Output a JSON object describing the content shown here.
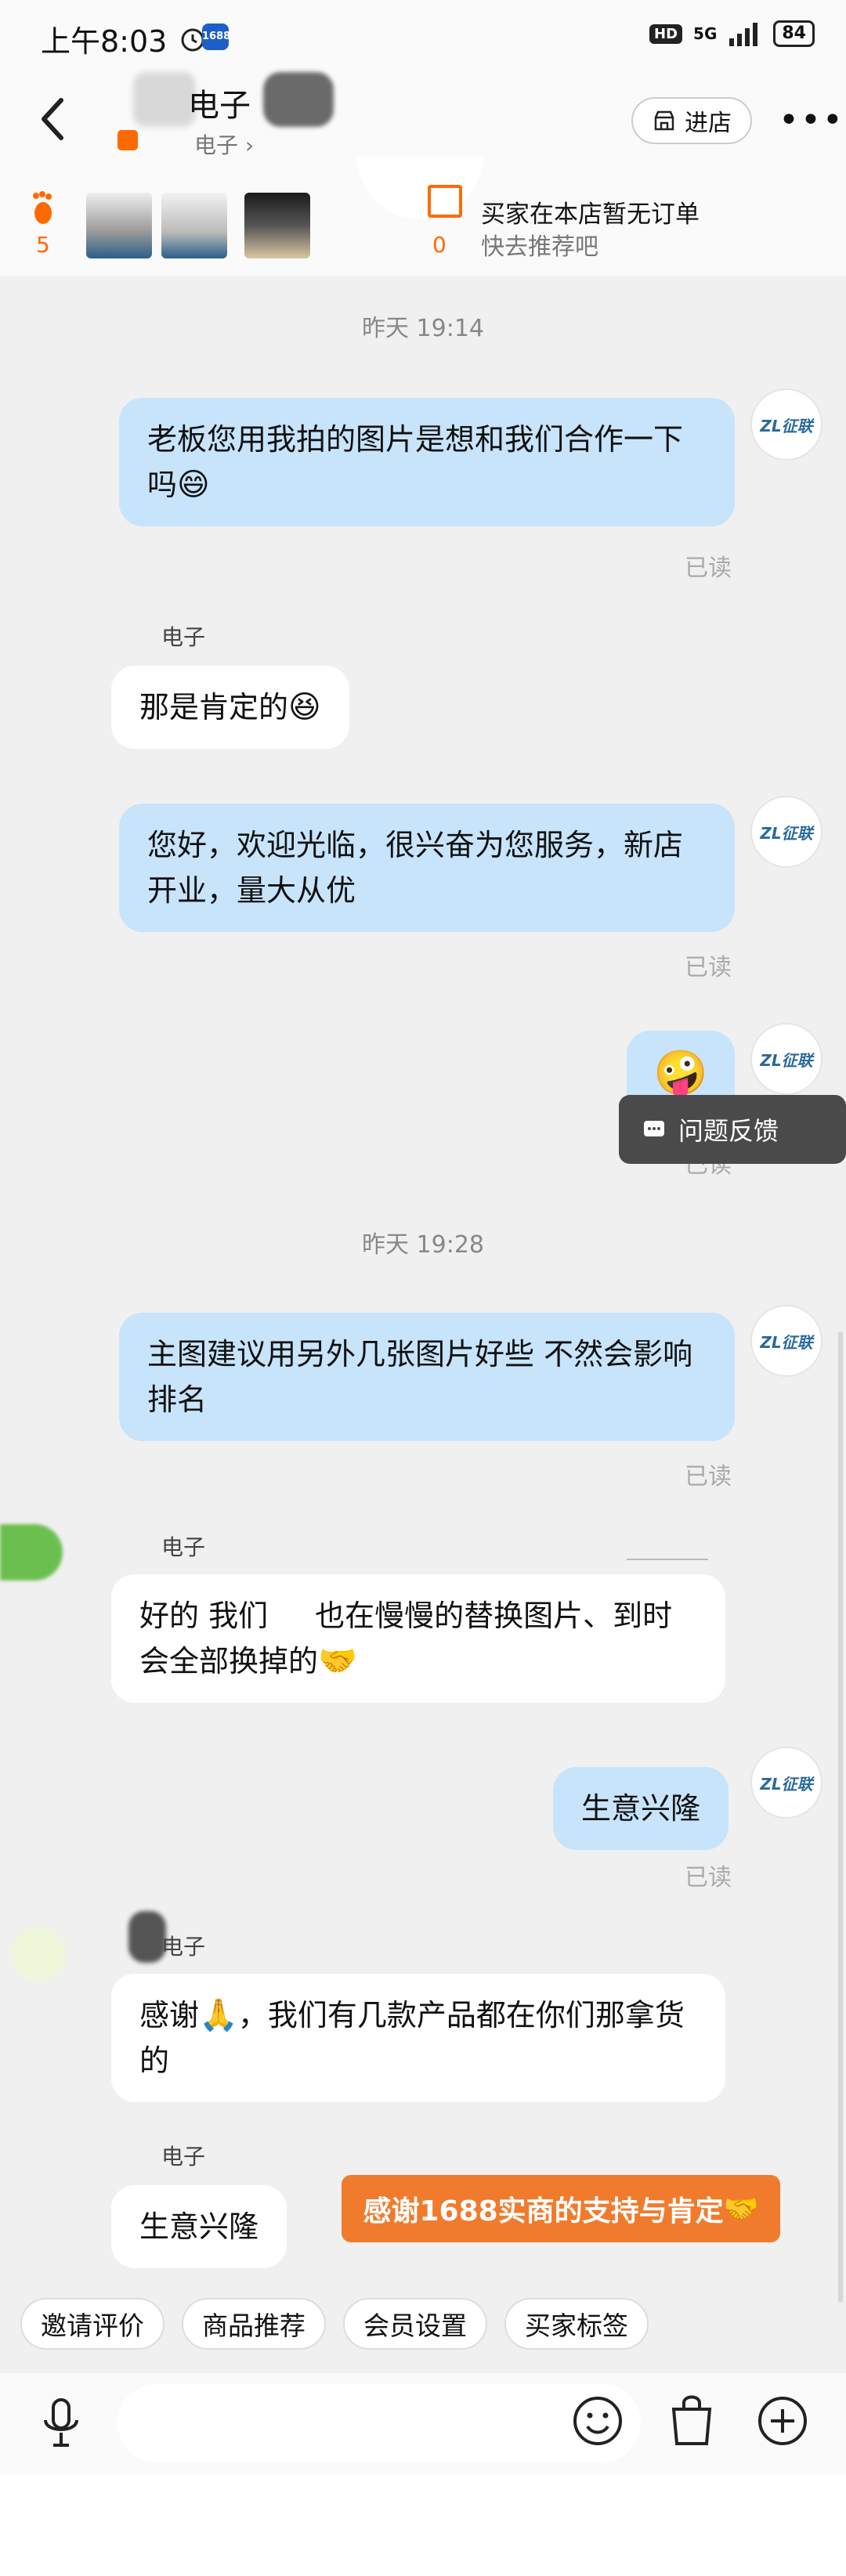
{
  "status_bar": {
    "time": "上午8:03",
    "app_badge": "1688",
    "network": "5G",
    "hd": "HD",
    "battery": "84"
  },
  "header": {
    "title": "电子",
    "subtitle": "电子 ›",
    "shop_button": "进店",
    "more": "•••"
  },
  "summary": {
    "footprint_count": "5",
    "order_count": "0",
    "order_text": "买家在本店暂无订单",
    "order_hint": "快去推荐吧"
  },
  "avatar_logo": "ZL征联",
  "messages": {
    "t1": "昨天  19:14",
    "m1": "老板您用我拍的图片是想和我们合作一下吗",
    "m1_emoji": "😄",
    "read": "已读",
    "sender": "电子",
    "m2": "那是肯定的",
    "m2_emoji": "😆",
    "m3": "您好，欢迎光临，很兴奋为您服务，新店开业，量大从优",
    "m4_emoji": "🤪",
    "feedback": "问题反馈",
    "t2": "昨天  19:28",
    "m5": "主图建议用另外几张图片好些 不然会影响排名",
    "m6_part1": "好的 我们",
    "m6_part2": "也在慢慢的替换图片、到时会全部换掉的",
    "m6_emoji": "🤝",
    "m7": "生意兴隆",
    "m8_part1": "感谢",
    "m8_emoji": "🙏",
    "m8_part2": "，我们有几款产品都在你们那拿货的",
    "m9": "生意兴隆",
    "thanks_badge": "感谢1688实商的支持与肯定",
    "thanks_emoji": "🤝"
  },
  "quick_chips": [
    "邀请评价",
    "商品推荐",
    "会员设置",
    "买家标签"
  ],
  "colors": {
    "mine_bubble": "#c7e4fb",
    "accent_orange": "#f07b2d",
    "background": "#f0f0f0"
  }
}
